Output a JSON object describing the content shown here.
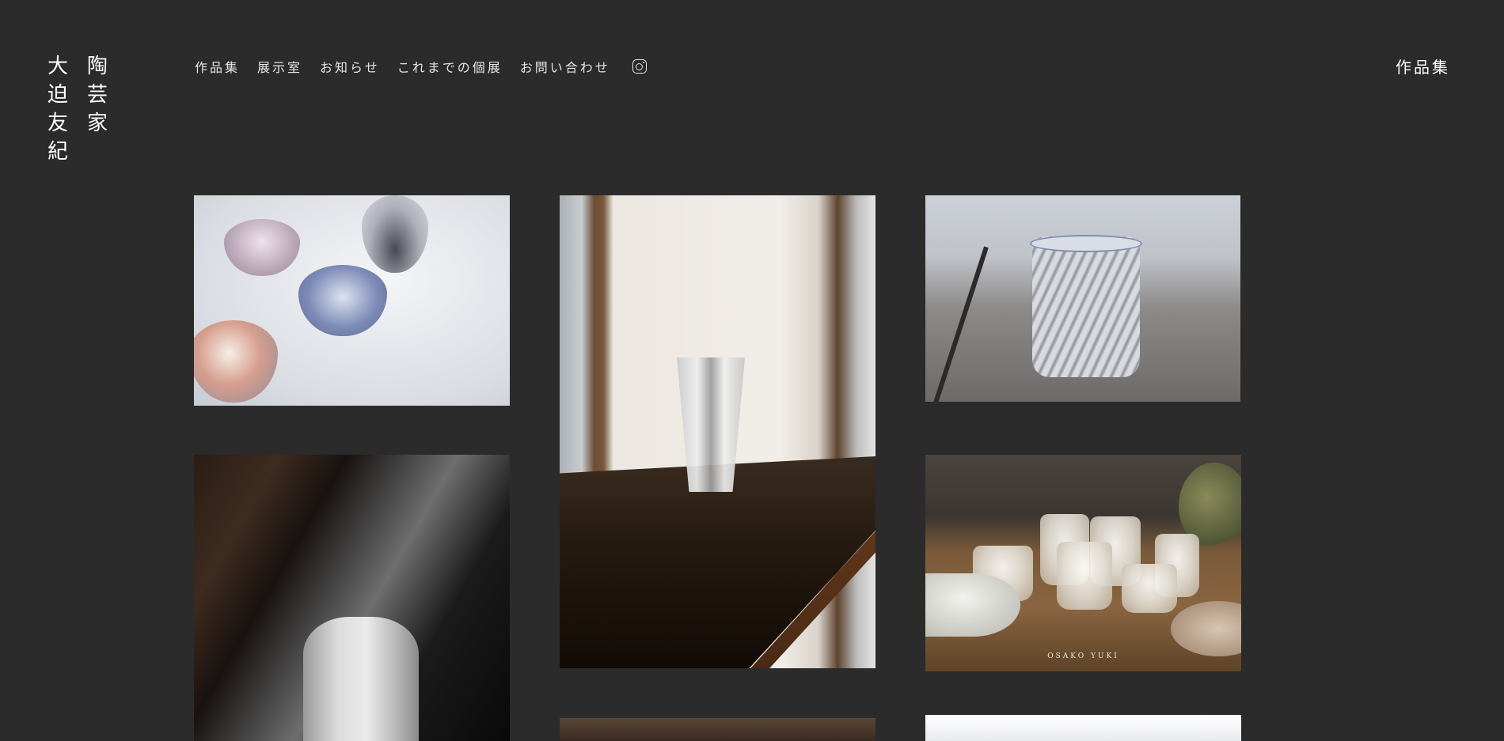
{
  "site": {
    "name_columns": [
      [
        "陶",
        "芸",
        "家"
      ],
      [
        "大",
        "迫",
        "友",
        "紀"
      ]
    ]
  },
  "nav": {
    "items": [
      "作品集",
      "展示室",
      "お知らせ",
      "これまでの個展",
      "お問い合わせ"
    ],
    "social_icon": "instagram-icon"
  },
  "page": {
    "heading": "作品集"
  },
  "gallery": {
    "photo_5_caption": "OSAKO YUKI"
  }
}
